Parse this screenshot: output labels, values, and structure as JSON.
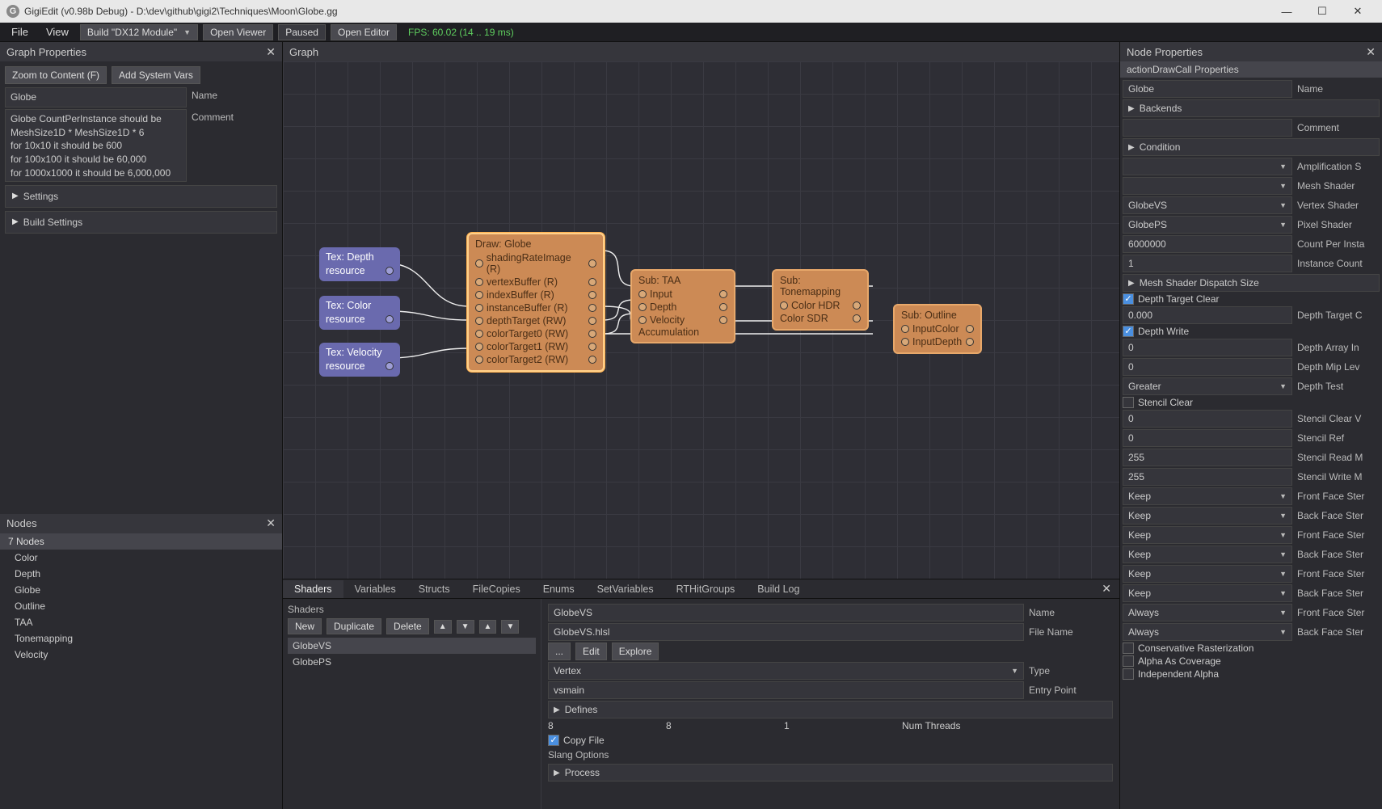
{
  "app": {
    "title": "GigiEdit (v0.98b Debug) - D:\\dev\\github\\gigi2\\Techniques\\Moon\\Globe.gg",
    "icon_letter": "G"
  },
  "menubar": {
    "file": "File",
    "view": "View",
    "build_module": "Build \"DX12 Module\"",
    "open_viewer": "Open Viewer",
    "paused": "Paused",
    "open_editor": "Open Editor",
    "fps": "FPS: 60.02 (14 .. 19 ms)"
  },
  "graph_props": {
    "title": "Graph Properties",
    "zoom_btn": "Zoom to Content (F)",
    "add_vars_btn": "Add System Vars",
    "name_value": "Globe",
    "name_label": "Name",
    "comment_value": "Globe CountPerInstance should be MeshSize1D * MeshSize1D * 6\nfor 10x10 it should be 600\nfor 100x100 it should be 60,000\nfor 1000x1000 it should be 6,000,000",
    "comment_label": "Comment",
    "settings": "Settings",
    "build_settings": "Build Settings"
  },
  "nodes_panel": {
    "title": "Nodes",
    "summary": "7 Nodes",
    "items": [
      "Color",
      "Depth",
      "Globe",
      "Outline",
      "TAA",
      "Tonemapping",
      "Velocity"
    ]
  },
  "graph": {
    "title": "Graph",
    "nodes": {
      "depth": {
        "title": "Tex: Depth",
        "sub": "resource"
      },
      "color": {
        "title": "Tex: Color",
        "sub": "resource"
      },
      "velocity": {
        "title": "Tex: Velocity",
        "sub": "resource"
      },
      "globe": {
        "title": "Draw: Globe",
        "ports": [
          "shadingRateImage (R)",
          "vertexBuffer (R)",
          "indexBuffer (R)",
          "instanceBuffer (R)",
          "depthTarget (RW)",
          "colorTarget0 (RW)",
          "colorTarget1 (RW)",
          "colorTarget2 (RW)"
        ]
      },
      "taa": {
        "title": "Sub: TAA",
        "inputs": [
          "Input",
          "Depth",
          "Velocity"
        ],
        "footer": "Accumulation"
      },
      "tone": {
        "title": "Sub: Tonemapping",
        "inputs": [
          "Color HDR"
        ],
        "outputs": [
          "Color SDR"
        ]
      },
      "outline": {
        "title": "Sub: Outline",
        "inputs": [
          "InputColor",
          "InputDepth"
        ]
      }
    }
  },
  "bottom": {
    "tabs": [
      "Shaders",
      "Variables",
      "Structs",
      "FileCopies",
      "Enums",
      "SetVariables",
      "RTHitGroups",
      "Build Log"
    ],
    "shaders": {
      "heading": "Shaders",
      "btn_new": "New",
      "btn_dup": "Duplicate",
      "btn_del": "Delete",
      "items": [
        "GlobeVS",
        "GlobePS"
      ],
      "name_value": "GlobeVS",
      "name_label": "Name",
      "filename_value": "GlobeVS.hlsl",
      "filename_label": "File Name",
      "dots": "...",
      "edit": "Edit",
      "explore": "Explore",
      "type_value": "Vertex",
      "type_label": "Type",
      "entry_value": "vsmain",
      "entry_label": "Entry Point",
      "defines": "Defines",
      "threads": [
        "8",
        "8",
        "1"
      ],
      "threads_label": "Num Threads",
      "copy_file": "Copy File",
      "slang": "Slang Options",
      "process": "Process"
    }
  },
  "node_props": {
    "title": "Node Properties",
    "subtitle": "actionDrawCall Properties",
    "name_value": "Globe",
    "name_label": "Name",
    "backends": "Backends",
    "comment_value": "",
    "comment_label": "Comment",
    "condition": "Condition",
    "amp_value": "",
    "amp_label": "Amplification S",
    "mesh_shader_value": "",
    "mesh_shader_label": "Mesh Shader",
    "vs_value": "GlobeVS",
    "vs_label": "Vertex Shader",
    "ps_value": "GlobePS",
    "ps_label": "Pixel Shader",
    "cpi_value": "6000000",
    "cpi_label": "Count Per Insta",
    "ic_value": "1",
    "ic_label": "Instance Count",
    "mesh_dispatch": "Mesh Shader Dispatch Size",
    "depth_target_clear": "Depth Target Clear",
    "dtc_value": "0.000",
    "dtc_label": "Depth Target C",
    "depth_write": "Depth Write",
    "dai_value": "0",
    "dai_label": "Depth Array In",
    "dml_value": "0",
    "dml_label": "Depth Mip Lev",
    "dt_value": "Greater",
    "dt_label": "Depth Test",
    "stencil_clear": "Stencil Clear",
    "scv_value": "0",
    "scv_label": "Stencil Clear V",
    "sref_value": "0",
    "sref_label": "Stencil Ref",
    "srm_value": "255",
    "srm_label": "Stencil Read M",
    "swm_value": "255",
    "swm_label": "Stencil Write M",
    "keep_rows": [
      {
        "v": "Keep",
        "l": "Front Face Ster"
      },
      {
        "v": "Keep",
        "l": "Back Face Ster"
      },
      {
        "v": "Keep",
        "l": "Front Face Ster"
      },
      {
        "v": "Keep",
        "l": "Back Face Ster"
      },
      {
        "v": "Keep",
        "l": "Front Face Ster"
      },
      {
        "v": "Keep",
        "l": "Back Face Ster"
      },
      {
        "v": "Always",
        "l": "Front Face Ster"
      },
      {
        "v": "Always",
        "l": "Back Face Ster"
      }
    ],
    "conservative": "Conservative Rasterization",
    "alpha_cov": "Alpha As Coverage",
    "indep_alpha": "Independent Alpha"
  }
}
